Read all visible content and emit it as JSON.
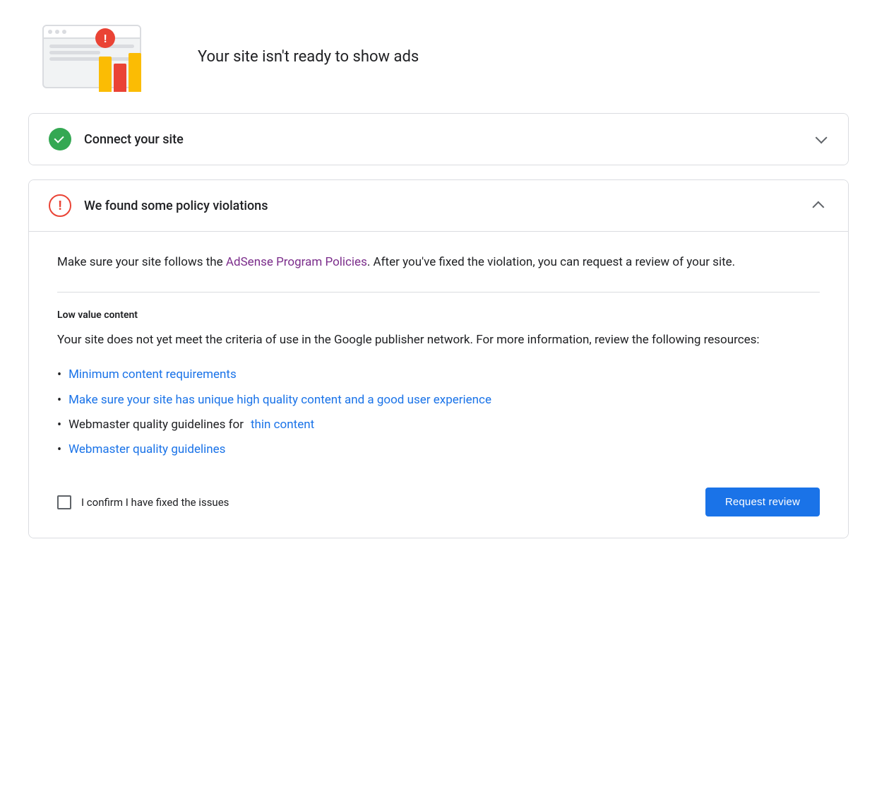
{
  "hero": {
    "subtitle": "Your site isn't ready to show ads"
  },
  "cards": {
    "connect_site": {
      "title": "Connect your site",
      "status": "complete",
      "expanded": false
    },
    "policy_violations": {
      "title": "We found some policy violations",
      "status": "warning",
      "expanded": true,
      "intro_text_before_link": "Make sure your site follows the ",
      "intro_link_text": "AdSense Program Policies",
      "intro_text_after_link": ". After you've fixed the violation, you can request a review of your site.",
      "violation_label": "Low value content",
      "violation_desc": "Your site does not yet meet the criteria of use in the Google publisher network. For more information, review the following resources:",
      "resources": [
        {
          "text": "Minimum content requirements",
          "link": true,
          "prefix": "",
          "suffix": ""
        },
        {
          "text": "Make sure your site has unique high quality content and a good user experience",
          "link": true,
          "prefix": "",
          "suffix": ""
        },
        {
          "text_before_link": "Webmaster quality guidelines for ",
          "link_text": "thin content",
          "link": true,
          "mixed": true,
          "text_after_link": ""
        },
        {
          "text": "Webmaster quality guidelines",
          "link": true,
          "prefix": "",
          "suffix": ""
        }
      ],
      "confirm_label": "I confirm I have fixed the issues",
      "request_review_button": "Request review"
    }
  }
}
